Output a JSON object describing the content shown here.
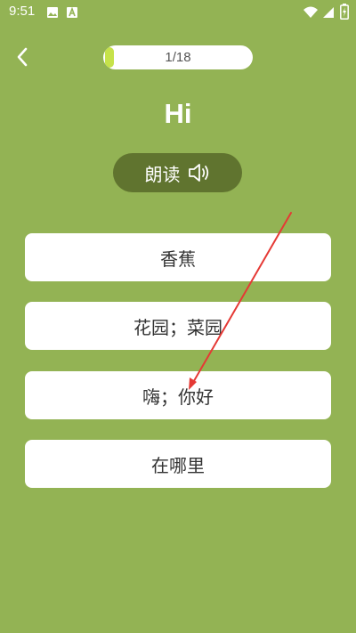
{
  "status_bar": {
    "time": "9:51",
    "icons": [
      "image-icon",
      "text-a-icon",
      "wifi-icon",
      "signal-icon",
      "battery-charging-icon"
    ]
  },
  "header": {
    "back_icon": "chevron-left-icon",
    "progress_text": "1/18",
    "progress_fraction": 0.056
  },
  "quiz": {
    "word": "Hi",
    "read_aloud_label": "朗读",
    "read_aloud_icon": "speaker-icon",
    "options": [
      {
        "label": "香蕉"
      },
      {
        "label": "花园；菜园"
      },
      {
        "label": "嗨；你好"
      },
      {
        "label": "在哪里"
      }
    ]
  },
  "colors": {
    "background": "#93b354",
    "read_button": "#60742f",
    "progress_fill": "#c6e24a",
    "annotation_arrow": "#e53935"
  }
}
